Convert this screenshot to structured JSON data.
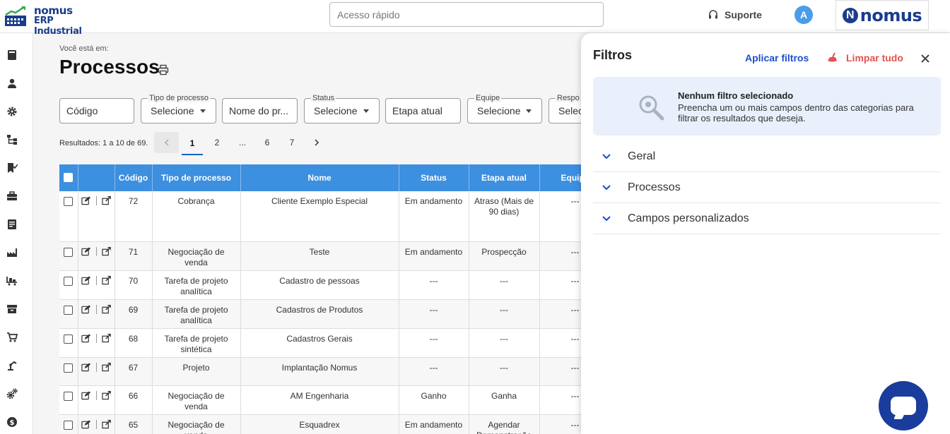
{
  "app": {
    "logo_line1": "nomus",
    "logo_line2": "ERP Industrial",
    "quick_access_placeholder": "Acesso rápido",
    "support_label": "Suporte",
    "avatar_initial": "A",
    "brand_letter": "N",
    "brand_text": "nomus",
    "brand_color": "#1a3c8c"
  },
  "sidebar": {
    "icons": [
      "book-icon",
      "user-icon",
      "gear-icon",
      "hierarchy-icon",
      "bookmark-check-icon",
      "briefcase-icon",
      "report-icon",
      "factory-icon",
      "conveyor-icon",
      "archive-icon",
      "cart-icon",
      "robot-arm-icon",
      "gears-icon",
      "dollar-icon"
    ]
  },
  "page": {
    "breadcrumb": "Você está em:",
    "title": "Processos"
  },
  "filters_bar": {
    "codigo_placeholder": "Código",
    "tipo_label": "Tipo de processo",
    "tipo_value": "Selecione",
    "nome_placeholder": "Nome do pr...",
    "status_label": "Status",
    "status_value": "Selecione",
    "etapa_placeholder": "Etapa atual",
    "equipe_label": "Equipe",
    "equipe_value": "Selecione",
    "resp_label": "Respo",
    "resp_value": "Selec"
  },
  "results": {
    "text": "Resultados: 1 a 10 de 69.",
    "pages": [
      "1",
      "2",
      "...",
      "6",
      "7"
    ],
    "current_page": "1"
  },
  "table": {
    "headers": [
      "Código",
      "Tipo de processo",
      "Nome",
      "Status",
      "Etapa atual",
      "Equip"
    ],
    "rows": [
      {
        "codigo": "72",
        "tipo": "Cobrança",
        "nome": "Cliente Exemplo Especial",
        "status": "Em andamento",
        "etapa": "Atraso (Mais de 90 dias)",
        "equipe": "---"
      },
      {
        "codigo": "71",
        "tipo": "Negociação de venda",
        "nome": "Teste",
        "status": "Em andamento",
        "etapa": "Prospecção",
        "equipe": "---"
      },
      {
        "codigo": "70",
        "tipo": "Tarefa de projeto analítica",
        "nome": "Cadastro de pessoas",
        "status": "---",
        "etapa": "---",
        "equipe": "---"
      },
      {
        "codigo": "69",
        "tipo": "Tarefa de projeto analítica",
        "nome": "Cadastros de Produtos",
        "status": "---",
        "etapa": "---",
        "equipe": "---"
      },
      {
        "codigo": "68",
        "tipo": "Tarefa de projeto sintética",
        "nome": "Cadastros Gerais",
        "status": "---",
        "etapa": "---",
        "equipe": "---"
      },
      {
        "codigo": "67",
        "tipo": "Projeto",
        "nome": "Implantação Nomus",
        "status": "---",
        "etapa": "---",
        "equipe": "---"
      },
      {
        "codigo": "66",
        "tipo": "Negociação de venda",
        "nome": "AM Engenharia",
        "status": "Ganho",
        "etapa": "Ganha",
        "equipe": "---"
      },
      {
        "codigo": "65",
        "tipo": "Negociação de venda",
        "nome": "Esquadrex",
        "status": "Em andamento",
        "etapa": "Agendar Demonstração",
        "equipe": "---"
      }
    ]
  },
  "panel": {
    "title": "Filtros",
    "apply_label": "Aplicar filtros",
    "clear_label": "Limpar tudo",
    "notice_title": "Nenhum filtro selecionado",
    "notice_text": "Preencha um ou mais campos dentro das categorias para filtrar os resultados que deseja.",
    "sections": [
      "Geral",
      "Processos",
      "Campos personalizados"
    ],
    "apply_color": "#1a4dcc",
    "clear_color": "#e0534f"
  }
}
